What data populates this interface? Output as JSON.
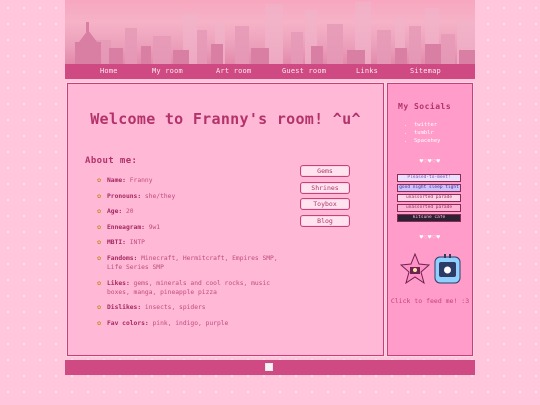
{
  "nav": [
    {
      "label": "Home"
    },
    {
      "label": "My room"
    },
    {
      "label": "Art room"
    },
    {
      "label": "Guest room"
    },
    {
      "label": "Links"
    },
    {
      "label": "Sitemap"
    }
  ],
  "main": {
    "title": "Welcome to Franny's room! ^u^",
    "about_heading": "About me:",
    "facts": [
      {
        "key": "Name:",
        "value": "Franny"
      },
      {
        "key": "Pronouns:",
        "value": "she/they"
      },
      {
        "key": "Age:",
        "value": "20"
      },
      {
        "key": "Enneagram:",
        "value": "9w1"
      },
      {
        "key": "MBTI:",
        "value": "INTP"
      },
      {
        "key": "Fandoms:",
        "value": "Minecraft, Hermitcraft, Empires SMP, Life Series SMP"
      },
      {
        "key": "Likes:",
        "value": "gems, minerals and cool rocks, music boxes, manga, pineapple pizza"
      },
      {
        "key": "Dislikes:",
        "value": "insects, spiders"
      },
      {
        "key": "Fav colors:",
        "value": "pink, indigo, purple"
      }
    ],
    "side_buttons": [
      {
        "label": "Gems"
      },
      {
        "label": "Shrines"
      },
      {
        "label": "Toybox"
      },
      {
        "label": "Blog"
      }
    ]
  },
  "social": {
    "heading": "My Socials",
    "links": [
      {
        "label": "twitter"
      },
      {
        "label": "tumblr"
      },
      {
        "label": "Spacehey"
      }
    ],
    "hearts": "♥♡♥♡♥",
    "badges": [
      {
        "label": "Pleased-to-meet!",
        "bg": "#e8e2ff",
        "fg": "#7a4fb8"
      },
      {
        "label": "good night sleep tight",
        "bg": "#c9c3ff",
        "fg": "#4b2c8c"
      },
      {
        "label": "unassorted parade",
        "bg": "#ffd6e8",
        "fg": "#8b2a57"
      },
      {
        "label": "unassorted parade",
        "bg": "#ffb3d4",
        "fg": "#8b2a57"
      },
      {
        "label": "kitsune cafe",
        "bg": "#2a2233",
        "fg": "#ffc4de"
      }
    ],
    "feed_text": "Click to feed me! :3"
  },
  "colors": {
    "accent": "#cf4a82",
    "heading": "#b3326a",
    "panel": "#ffb9d6",
    "sidebar": "#ff9cc9"
  }
}
